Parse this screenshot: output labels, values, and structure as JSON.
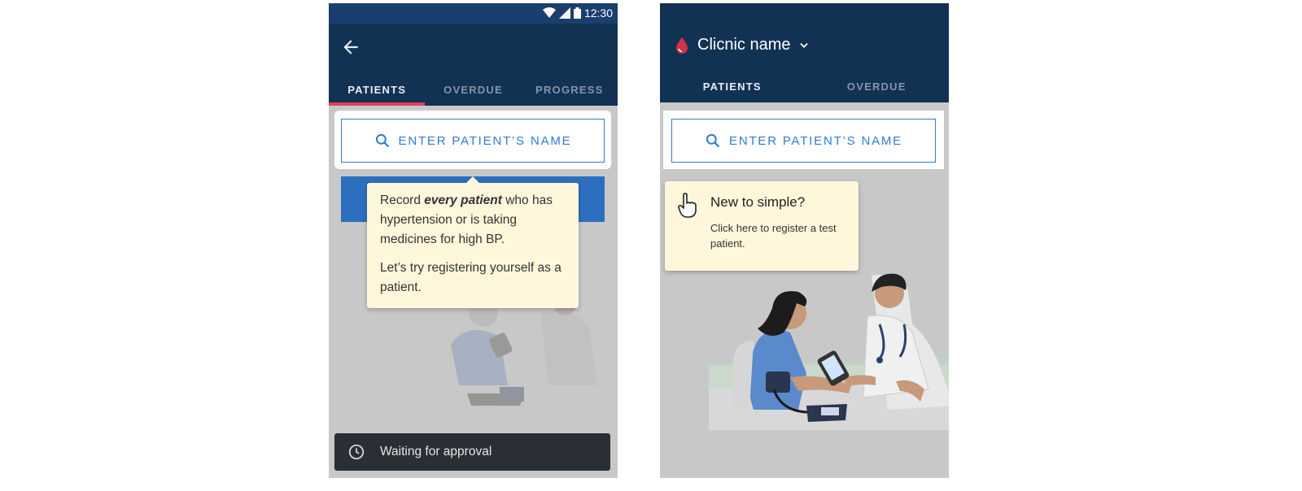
{
  "screen1": {
    "status_time": "12:30",
    "tabs": [
      "PATIENTS",
      "OVERDUE",
      "PROGRESS"
    ],
    "search_label": "ENTER PATIENT’S NAME",
    "tooltip": {
      "before": "Record ",
      "emphasis": "every patient",
      "after": " who has hypertension or is taking medicines for high BP.",
      "second": "Let’s try registering yourself as a patient."
    },
    "snackbar": "Waiting for approval"
  },
  "screen2": {
    "clinic_name": "Clicnic name",
    "tabs": [
      "PATIENTS",
      "OVERDUE"
    ],
    "search_label": "ENTER PATIENT’S NAME",
    "tooltip_title": "New to simple?",
    "tooltip_body": "Click here to register a test patient."
  },
  "colors": {
    "appbar": "#123254",
    "accent": "#2f7bd6",
    "tab_indicator": "#e0405e",
    "tooltip_bg": "#fff7dc"
  }
}
